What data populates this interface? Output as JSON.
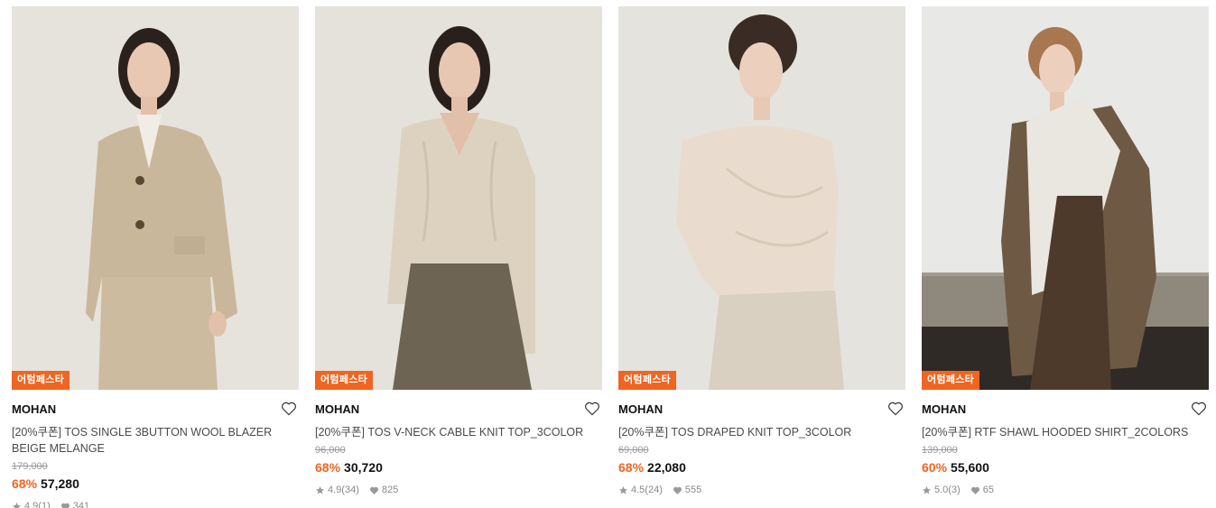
{
  "products": [
    {
      "badge": "어텀페스타",
      "brand": "MOHAN",
      "name": "[20%쿠폰] TOS SINGLE 3BUTTON WOOL BLAZER BEIGE MELANGE",
      "original_price": "179,000",
      "discount": "68%",
      "price": "57,280",
      "rating": "4.9",
      "review_count": "(1)",
      "likes": "341",
      "image_icon": "model-beige-blazer-photo"
    },
    {
      "badge": "어텀페스타",
      "brand": "MOHAN",
      "name": "[20%쿠폰] TOS V-NECK CABLE KNIT TOP_3COLOR",
      "original_price": "96,000",
      "discount": "68%",
      "price": "30,720",
      "rating": "4.9",
      "review_count": "(34)",
      "likes": "825",
      "image_icon": "model-cable-knit-photo"
    },
    {
      "badge": "어텀페스타",
      "brand": "MOHAN",
      "name": "[20%쿠폰] TOS DRAPED KNIT TOP_3COLOR",
      "original_price": "69,000",
      "discount": "68%",
      "price": "22,080",
      "rating": "4.5",
      "review_count": "(24)",
      "likes": "555",
      "image_icon": "model-draped-knit-photo"
    },
    {
      "badge": "어텀페스타",
      "brand": "MOHAN",
      "name": "[20%쿠폰] RTF SHAWL HOODED SHIRT_2COLORS",
      "original_price": "139,000",
      "discount": "60%",
      "price": "55,600",
      "rating": "5.0",
      "review_count": "(3)",
      "likes": "65",
      "image_icon": "model-hooded-shirt-photo"
    }
  ],
  "colors": {
    "accent": "#ef6521",
    "text": "#111111",
    "muted": "#888888"
  }
}
